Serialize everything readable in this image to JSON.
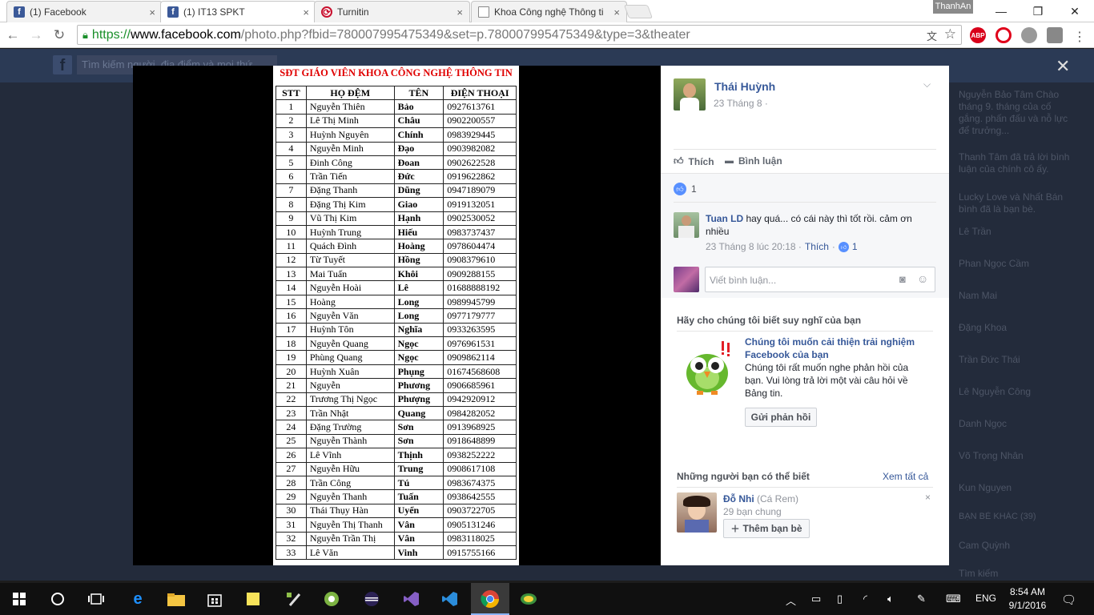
{
  "browser": {
    "tabs": [
      {
        "label": "(1) Facebook",
        "icon": "facebook-icon"
      },
      {
        "label": "(1) IT13 SPKT",
        "icon": "facebook-icon"
      },
      {
        "label": "Turnitin",
        "icon": "turnitin-icon"
      },
      {
        "label": "Khoa Công nghệ Thông ti",
        "icon": "page-icon"
      }
    ],
    "profile_name": "ThanhAn",
    "url_scheme": "https://",
    "url_host": "www.facebook.com",
    "url_path": "/photo.php?fbid=780007995475349&set=p.780007995475349&type=3&theater",
    "extensions": [
      "translate-icon",
      "star-icon",
      "adblock-icon",
      "opera-icon",
      "extension-icon",
      "extension-icon"
    ]
  },
  "facebook": {
    "search_placeholder": "Tìm kiếm người, địa điểm và mọi thứ",
    "right_sidebar": [
      "Nguyễn Bảo Tâm Chào tháng 9. tháng của cố gắng. phấn đấu và nỗ lực để trưởng...",
      "Thanh Tâm đã trả lời bình luận của chính cô ấy.",
      "Lucky Love và Nhất Bán bình đã là bạn bè.",
      "Lê Trần",
      "Phan Ngọc Cầm",
      "Nam Mai",
      "Đặng Khoa",
      "Trần Đức Thái",
      "Lê Nguyễn Công",
      "Danh Ngọc",
      "Võ Trọng Nhân",
      "Kun Nguyen",
      "BẠN BÈ KHÁC (39)",
      "Cam Quỳnh",
      "Tìm kiếm"
    ]
  },
  "document": {
    "title": "SĐT GIÁO VIÊN KHOA CÔNG NGHỆ THÔNG TIN",
    "headers": [
      "STT",
      "HỌ ĐỆM",
      "TÊN",
      "ĐIỆN THOẠI"
    ],
    "rows": [
      [
        "1",
        "Nguyễn Thiên",
        "Bảo",
        "0927613761"
      ],
      [
        "2",
        "Lê Thị Minh",
        "Châu",
        "0902200557"
      ],
      [
        "3",
        "Huỳnh Nguyên",
        "Chính",
        "0983929445"
      ],
      [
        "4",
        "Nguyễn Minh",
        "Đạo",
        "0903982082"
      ],
      [
        "5",
        "Đinh Công",
        "Đoan",
        "0902622528"
      ],
      [
        "6",
        "Trần Tiến",
        "Đức",
        "0919622862"
      ],
      [
        "7",
        "Đặng Thanh",
        "Dũng",
        "0947189079"
      ],
      [
        "8",
        "Đặng Thị Kim",
        "Giao",
        "0919132051"
      ],
      [
        "9",
        "Vũ Thị Kim",
        "Hạnh",
        "0902530052"
      ],
      [
        "10",
        "Huỳnh Trung",
        "Hiếu",
        "0983737437"
      ],
      [
        "11",
        "Quách Đình",
        "Hoàng",
        "0978604474"
      ],
      [
        "12",
        "Từ Tuyết",
        "Hồng",
        "0908379610"
      ],
      [
        "13",
        "Mai Tuấn",
        "Khôi",
        "0909288155"
      ],
      [
        "14",
        "Nguyễn Hoài",
        "Lê",
        "01688888192"
      ],
      [
        "15",
        "Hoàng",
        "Long",
        "0989945799"
      ],
      [
        "16",
        "Nguyễn Văn",
        "Long",
        "0977179777"
      ],
      [
        "17",
        "Huỳnh Tôn",
        "Nghĩa",
        "0933263595"
      ],
      [
        "18",
        "Nguyễn Quang",
        "Ngọc",
        "0976961531"
      ],
      [
        "19",
        "Phùng Quang",
        "Ngọc",
        "0909862114"
      ],
      [
        "20",
        "Huỳnh Xuân",
        "Phụng",
        "01674568608"
      ],
      [
        "21",
        "Nguyễn",
        "Phương",
        "0906685961"
      ],
      [
        "22",
        "Trương Thị Ngọc",
        "Phượng",
        "0942920912"
      ],
      [
        "23",
        "Trần Nhật",
        "Quang",
        "0984282052"
      ],
      [
        "24",
        "Đặng Trường",
        "Sơn",
        "0913968925"
      ],
      [
        "25",
        "Nguyễn Thành",
        "Sơn",
        "0918648899"
      ],
      [
        "26",
        "Lê Vĩnh",
        "Thịnh",
        "0938252222"
      ],
      [
        "27",
        "Nguyễn Hữu",
        "Trung",
        "0908617108"
      ],
      [
        "28",
        "Trần Công",
        "Tú",
        "0983674375"
      ],
      [
        "29",
        "Nguyễn Thanh",
        "Tuấn",
        "0938642555"
      ],
      [
        "30",
        "Thái Thụy Hàn",
        "Uyển",
        "0903722705"
      ],
      [
        "31",
        "Nguyễn Thị Thanh",
        "Vân",
        "0905131246"
      ],
      [
        "32",
        "Nguyễn Trần Thị",
        "Vân",
        "0983118025"
      ],
      [
        "33",
        "Lê Văn",
        "Vinh",
        "0915755166"
      ]
    ]
  },
  "panel": {
    "author": "Thái Huỳnh",
    "date": "23 Tháng 8 ·",
    "like_label": "Thích",
    "comment_label": "Bình luận",
    "like_count": "1",
    "comment": {
      "author": "Tuan LD",
      "text": "hay quá... có cái này thì tốt rồi. cảm ơn nhiều",
      "time": "23 Tháng 8 lúc 20:18 ·",
      "like": "Thích",
      "sep": "·",
      "likes": "1"
    },
    "comment_placeholder": "Viết bình luận...",
    "feedback": {
      "heading": "Hãy cho chúng tôi biết suy nghĩ của bạn",
      "title": "Chúng tôi muốn cải thiện trải nghiệm Facebook của bạn",
      "body": "Chúng tôi rất muốn nghe phản hồi của bạn. Vui lòng trả lời một vài câu hỏi về Bảng tin.",
      "button": "Gửi phản hồi"
    },
    "pymk": {
      "heading": "Những người bạn có thể biết",
      "see_all": "Xem tất cả",
      "name": "Đỗ Nhi",
      "alias": "(Cá Rem)",
      "mutual": "29 bạn chung",
      "add": "Thêm bạn bè"
    }
  },
  "taskbar": {
    "language": "ENG",
    "time": "8:54 AM",
    "date": "9/1/2016"
  }
}
